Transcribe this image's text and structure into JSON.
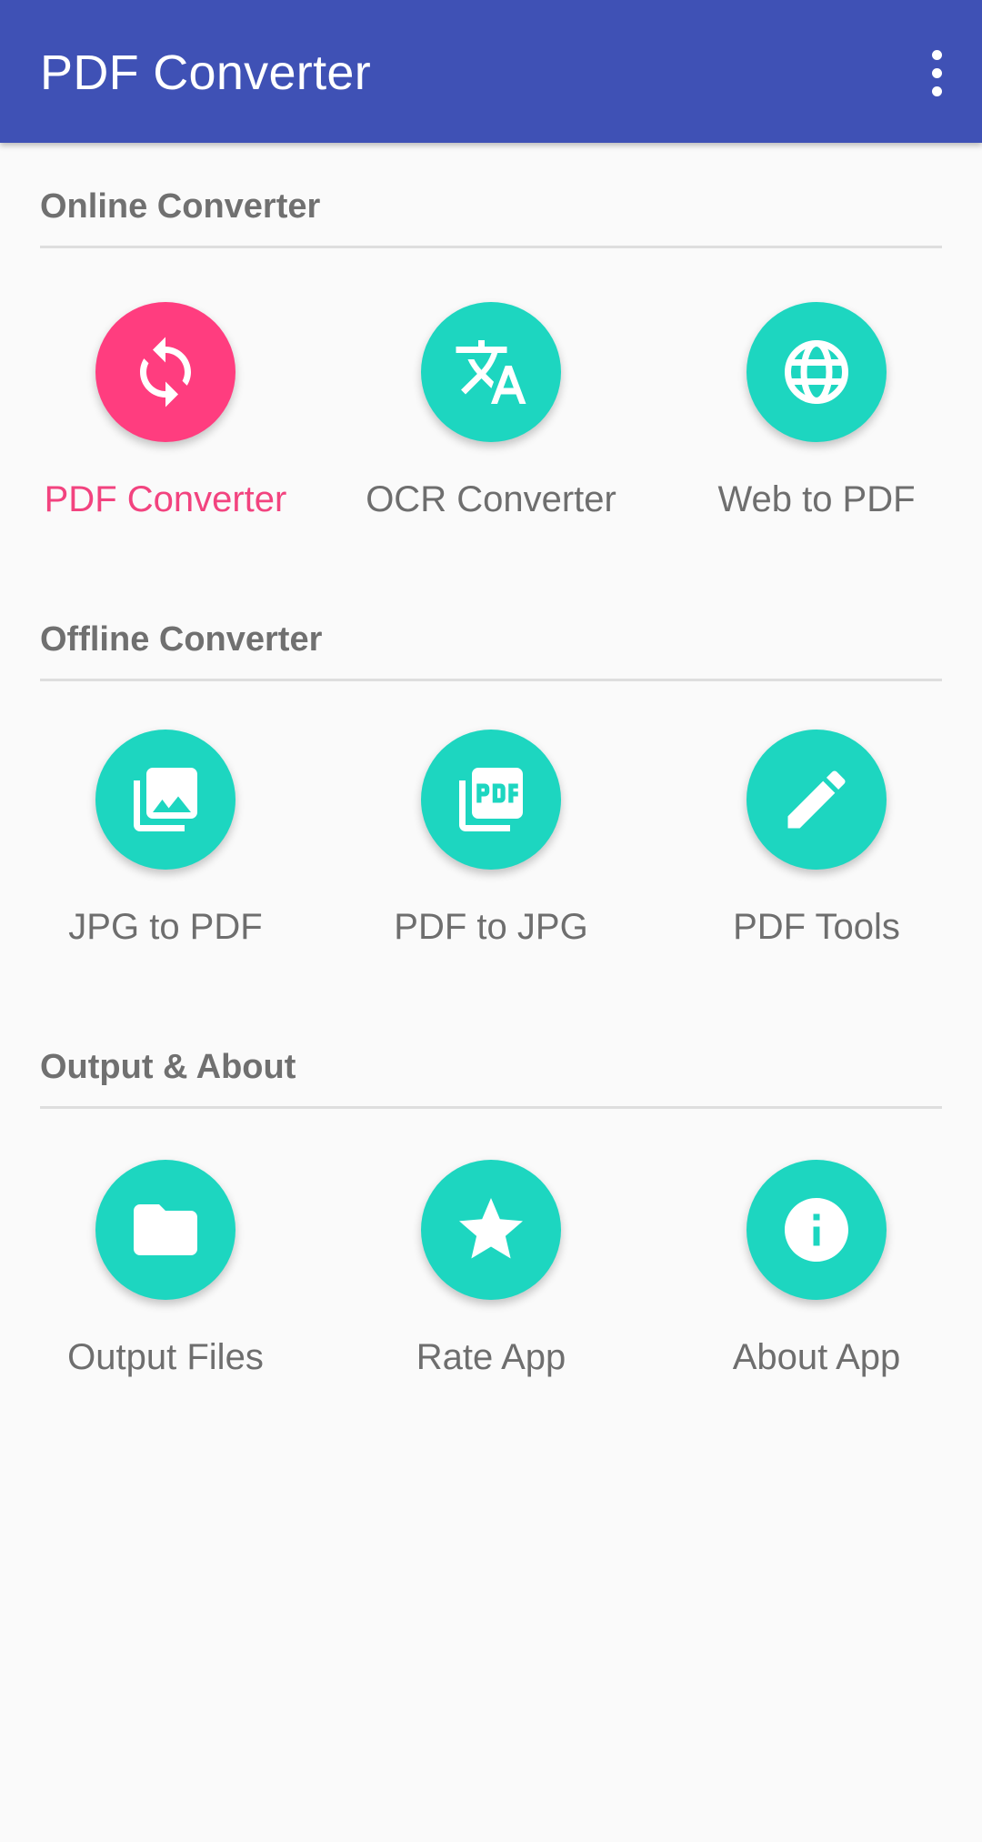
{
  "app_bar": {
    "title": "PDF Converter",
    "overflow_icon": "more-vert-icon"
  },
  "colors": {
    "primary": "#3F51B5",
    "accent": "#FF3D7F",
    "tile": "#1DD6C0",
    "background": "#FAFAFA"
  },
  "sections": [
    {
      "title": "Online Converter",
      "items": [
        {
          "label": "PDF Converter",
          "icon": "sync-icon",
          "active": true
        },
        {
          "label": "OCR Converter",
          "icon": "translate-icon",
          "active": false
        },
        {
          "label": "Web to PDF",
          "icon": "globe-icon",
          "active": false
        }
      ]
    },
    {
      "title": "Offline Converter",
      "items": [
        {
          "label": "JPG to PDF",
          "icon": "photo-library-icon",
          "active": false
        },
        {
          "label": "PDF to JPG",
          "icon": "pdf-library-icon",
          "active": false
        },
        {
          "label": "PDF Tools",
          "icon": "pencil-icon",
          "active": false
        }
      ]
    },
    {
      "title": "Output & About",
      "items": [
        {
          "label": "Output Files",
          "icon": "folder-icon",
          "active": false
        },
        {
          "label": "Rate App",
          "icon": "star-icon",
          "active": false
        },
        {
          "label": "About App",
          "icon": "info-icon",
          "active": false
        }
      ]
    }
  ]
}
